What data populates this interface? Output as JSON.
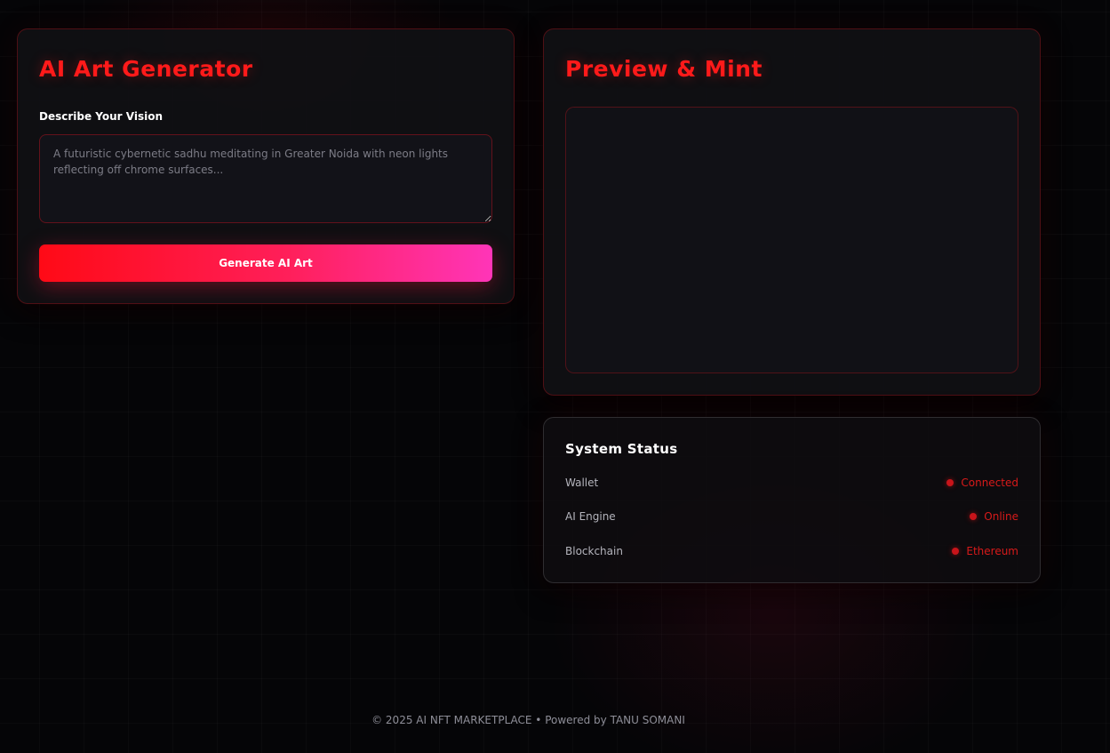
{
  "generator": {
    "title": "AI Art Generator",
    "vision_label": "Describe Your Vision",
    "prompt_placeholder": "A futuristic cybernetic sadhu meditating in Greater Noida with neon lights reflecting off chrome surfaces...",
    "prompt_value": "",
    "generate_label": "Generate AI Art"
  },
  "preview": {
    "title": "Preview & Mint"
  },
  "status": {
    "title": "System Status",
    "rows": [
      {
        "label": "Wallet",
        "value": "Connected"
      },
      {
        "label": "AI Engine",
        "value": "Online"
      },
      {
        "label": "Blockchain",
        "value": "Ethereum"
      }
    ]
  },
  "footer": {
    "text": "© 2025 AI NFT MARKETPLACE • Powered by TANU SOMANI"
  },
  "colors": {
    "accent": "#ff1a1a",
    "button_gradient_start": "#ff0a16",
    "button_gradient_end": "#ff35b8",
    "status_ok": "#d81a1a",
    "background": "#050507"
  }
}
